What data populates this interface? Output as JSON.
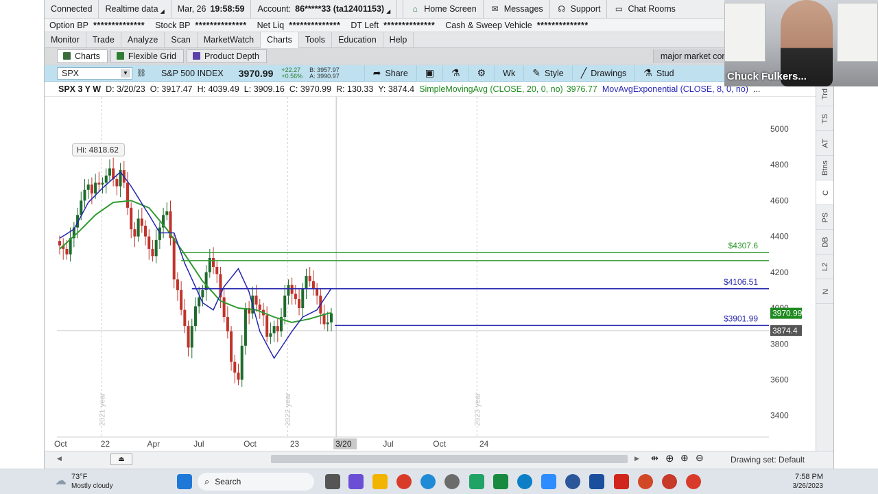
{
  "status_bar": {
    "connected": "Connected",
    "realtime": "Realtime data",
    "date": "Mar, 26",
    "time": "19:58:59",
    "account_label": "Account:",
    "account_value": "86*****33 (ta12401153)",
    "home": "Home Screen",
    "messages": "Messages",
    "support": "Support",
    "chat": "Chat Rooms"
  },
  "buying_power": [
    {
      "label": "Option BP",
      "value": "**************"
    },
    {
      "label": "Stock BP",
      "value": "**************"
    },
    {
      "label": "Net Liq",
      "value": "**************"
    },
    {
      "label": "DT Left",
      "value": "**************"
    },
    {
      "label": "Cash & Sweep Vehicle",
      "value": "**************"
    }
  ],
  "menu": [
    "Monitor",
    "Trade",
    "Analyze",
    "Scan",
    "MarketWatch",
    "Charts",
    "Tools",
    "Education",
    "Help"
  ],
  "sub_tabs": {
    "charts": "Charts",
    "grid": "Flexible Grid",
    "depth": "Product Depth",
    "comparison": "major market comparisons"
  },
  "symbol_bar": {
    "symbol": "SPX",
    "index_name": "S&P 500 INDEX",
    "last": "3970.99",
    "change": "+22.27",
    "change_pct": "+0.56%",
    "bid": "B: 3957.97",
    "ask": "A: 3990.97",
    "share": "Share",
    "period": "Wk",
    "style": "Style",
    "drawings": "Drawings",
    "studies": "Stud"
  },
  "study_line": {
    "symbol": "SPX 3 Y W",
    "date": "D: 3/20/23",
    "open": "O: 3917.47",
    "high": "H: 4039.49",
    "low": "L: 3909.16",
    "close": "C: 3970.99",
    "range": "R: 130.33",
    "y": "Y: 3874.4",
    "sma_label": "SimpleMovingAvg (CLOSE, 20, 0, no)",
    "sma_value": "3976.77",
    "ema_label": "MovAvgExponential (CLOSE, 8, 0, no)",
    "more": "..."
  },
  "chart_data": {
    "type": "candlestick",
    "timeframe": "weekly, 3 years",
    "y_ticks": [
      3400,
      3600,
      3800,
      4000,
      4200,
      4400,
      4600,
      4800,
      5000
    ],
    "ylim": [
      3280,
      5180
    ],
    "x_ticks": [
      {
        "label": "Oct",
        "week": 0
      },
      {
        "label": "22",
        "week": 13
      },
      {
        "label": "Apr",
        "week": 26
      },
      {
        "label": "Jul",
        "week": 39
      },
      {
        "label": "Oct",
        "week": 53
      },
      {
        "label": "23",
        "week": 66
      },
      {
        "label": "3/20",
        "week": 77
      },
      {
        "label": "Jul",
        "week": 92
      },
      {
        "label": "Oct",
        "week": 106
      },
      {
        "label": "24",
        "week": 119
      }
    ],
    "year_labels": [
      {
        "label": "2021 year",
        "week": 11
      },
      {
        "label": "2022 year",
        "week": 63
      },
      {
        "label": "2023 year",
        "week": 116
      }
    ],
    "hi_label": "Hi: 4818.62",
    "hi_week": 17,
    "hi_value": 4818.62,
    "closes": [
      4350,
      4330,
      4300,
      4390,
      4450,
      4520,
      4600,
      4660,
      4690,
      4640,
      4700,
      4690,
      4700,
      4740,
      4780,
      4720,
      4680,
      4770,
      4700,
      4560,
      4440,
      4400,
      4500,
      4460,
      4400,
      4330,
      4290,
      4380,
      4450,
      4520,
      4540,
      4390,
      4160,
      4100,
      3990,
      3900,
      3780,
      3900,
      4010,
      4060,
      4100,
      4200,
      4280,
      4230,
      4190,
      4060,
      3950,
      3870,
      3700,
      3640,
      3600,
      3790,
      4000,
      3970,
      4070,
      4020,
      3990,
      3960,
      3840,
      3860,
      3900,
      3870,
      3950,
      4070,
      4130,
      4080,
      4050,
      4000,
      4110,
      4180,
      4150,
      4110,
      4070,
      3970,
      3910,
      3920,
      3970.99
    ],
    "sma20_anchors": [
      [
        0,
        4330
      ],
      [
        5,
        4420
      ],
      [
        10,
        4520
      ],
      [
        15,
        4590
      ],
      [
        20,
        4600
      ],
      [
        25,
        4560
      ],
      [
        30,
        4440
      ],
      [
        35,
        4300
      ],
      [
        40,
        4150
      ],
      [
        45,
        4040
      ],
      [
        50,
        4000
      ],
      [
        55,
        3990
      ],
      [
        60,
        3950
      ],
      [
        65,
        3920
      ],
      [
        70,
        3940
      ],
      [
        75,
        3970
      ],
      [
        77,
        3976.77
      ]
    ],
    "ema8_anchors": [
      [
        0,
        4390
      ],
      [
        4,
        4440
      ],
      [
        8,
        4590
      ],
      [
        12,
        4670
      ],
      [
        17,
        4760
      ],
      [
        20,
        4680
      ],
      [
        25,
        4520
      ],
      [
        28,
        4420
      ],
      [
        32,
        4420
      ],
      [
        35,
        4250
      ],
      [
        40,
        4030
      ],
      [
        43,
        3990
      ],
      [
        46,
        4120
      ],
      [
        50,
        4220
      ],
      [
        53,
        4090
      ],
      [
        56,
        3870
      ],
      [
        60,
        3720
      ],
      [
        65,
        3870
      ],
      [
        68,
        3950
      ],
      [
        72,
        3990
      ],
      [
        76,
        4110
      ],
      [
        77,
        4060
      ]
    ],
    "levels": [
      {
        "label": "$4307.6",
        "value": 4310,
        "color": "#2f9a2f"
      },
      {
        "label": "",
        "value": 4265,
        "color": "#2f9a2f"
      },
      {
        "label": "$4106.51",
        "value": 4108,
        "color": "#2b2bb0"
      },
      {
        "label": "$3901.99",
        "value": 3903,
        "color": "#2b2bb0"
      }
    ],
    "price_badges": [
      {
        "label": "3970.99",
        "value": 3970.99,
        "color": "#1e8a1e"
      },
      {
        "label": "3874.4",
        "value": 3874.4,
        "color": "#555555"
      }
    ]
  },
  "right_tabs": [
    "Trd",
    "TS",
    "AT",
    "Btns",
    "C",
    "PS",
    "DB",
    "L2",
    "N"
  ],
  "bottom_bar": {
    "drawing_set": "Drawing set: Default"
  },
  "webcam": {
    "name": "Chuck Fulkers..."
  },
  "taskbar": {
    "temp": "73°F",
    "weather": "Mostly cloudy",
    "search": "Search",
    "time": "7:58 PM",
    "date": "3/26/2023"
  },
  "colors": {
    "green": "#1f8a1f",
    "blue": "#2828b8",
    "up": "#1e6b2e",
    "down": "#c0332b"
  }
}
